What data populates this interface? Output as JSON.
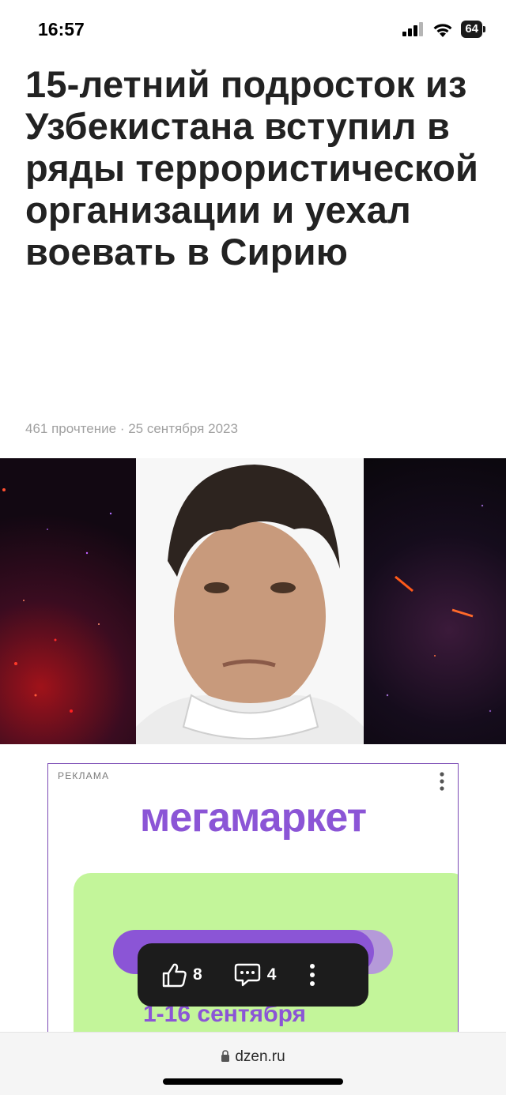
{
  "status": {
    "time": "16:57",
    "battery": "64"
  },
  "article": {
    "title": "15-летний подросток из Узбекистана вступил в ряды террористической организации и уехал воевать в Сирию",
    "reads": "461 прочтение",
    "separator": "·",
    "date": "25 сентября 2023"
  },
  "ad": {
    "label": "РЕКЛАМА",
    "brand": "мегамаркет",
    "dates": "1-16 сентября"
  },
  "actions": {
    "likes": "8",
    "comments": "4"
  },
  "browser": {
    "url": "dzen.ru"
  },
  "colors": {
    "brand": "#8b55d6",
    "panel": "#c3f59a",
    "float_bar": "#1c1c1c"
  }
}
